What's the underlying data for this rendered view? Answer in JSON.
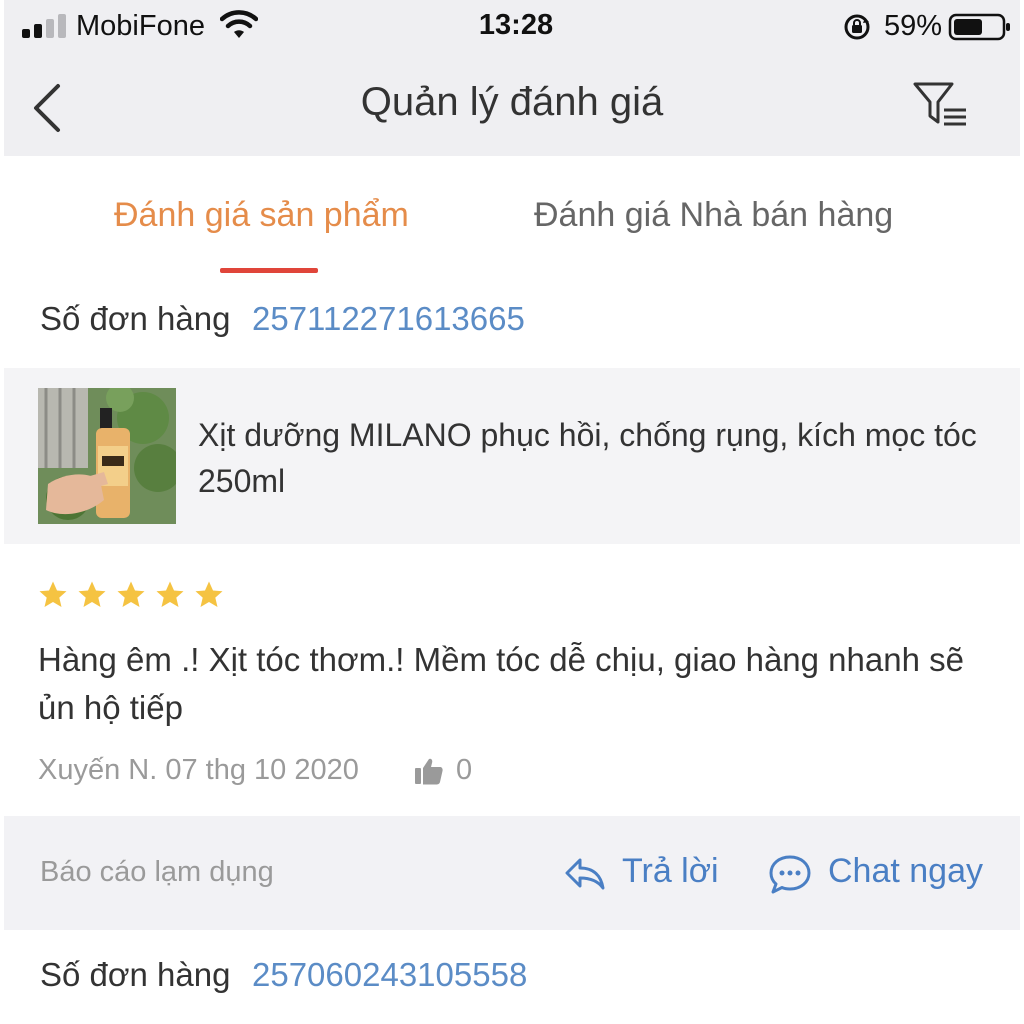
{
  "status_bar": {
    "carrier": "MobiFone",
    "time": "13:28",
    "battery_percent": "59%",
    "signal_bars_filled": 2,
    "signal_bars_total": 4
  },
  "nav": {
    "title": "Quản lý đánh giá",
    "back_icon": "chevron-left-icon",
    "filter_icon": "filter-list-icon"
  },
  "tabs": [
    {
      "label": "Đánh giá sản phẩm",
      "active": true
    },
    {
      "label": "Đánh giá Nhà bán hàng",
      "active": false
    }
  ],
  "reviews": [
    {
      "order_label": "Số đơn hàng",
      "order_number": "257112271613665",
      "product_name": "Xịt dưỡng MILANO phục hồi, chống rụng, kích mọc tóc 250ml",
      "rating": 5,
      "text": "Hàng êm .! Xịt tóc thơm.! Mềm tóc dễ chịu, giao hàng nhanh sẽ ủn hộ tiếp",
      "meta": "Xuyến N. 07 thg 10 2020",
      "likes": "0",
      "report_label": "Báo cáo lạm dụng",
      "reply_label": "Trả lời",
      "chat_label": "Chat ngay"
    },
    {
      "order_label": "Số đơn hàng",
      "order_number": "257060243105558"
    }
  ],
  "colors": {
    "accent_orange": "#e58c4a",
    "tab_underline": "#e0453a",
    "link_blue": "#4a7fc4",
    "star": "#f5c342"
  }
}
